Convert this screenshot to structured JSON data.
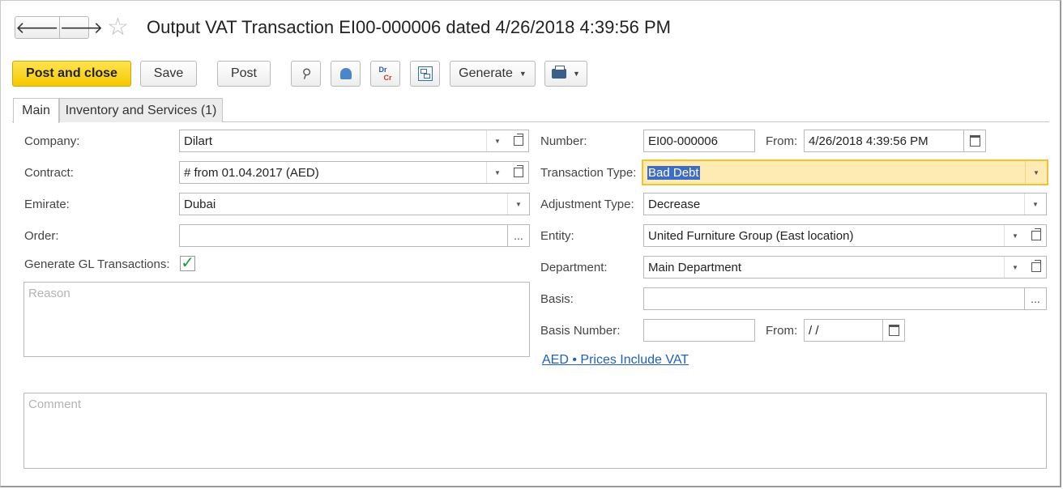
{
  "header": {
    "back_glyph": "🡐",
    "forward_glyph": "🡒",
    "star_glyph": "☆",
    "title": "Output VAT Transaction EI00-000006 dated 4/26/2018 4:39:56 PM"
  },
  "toolbar": {
    "post_and_close": "Post and close",
    "save": "Save",
    "post": "Post",
    "dr": "Dr",
    "cr": "Cr",
    "generate": "Generate",
    "clip_glyph": "⚲"
  },
  "tabs": [
    {
      "label": "Main"
    },
    {
      "label": "Inventory and Services (1)"
    }
  ],
  "form": {
    "company_label": "Company:",
    "company_value": "Dilart",
    "contract_label": "Contract:",
    "contract_value": "#  from 01.04.2017 (AED)",
    "emirate_label": "Emirate:",
    "emirate_value": "Dubai",
    "order_label": "Order:",
    "order_value": "",
    "gl_label": "Generate GL Transactions:",
    "gl_checked_glyph": "✓",
    "reason_placeholder": "Reason",
    "number_label": "Number:",
    "number_value": "EI00-000006",
    "from_label": "From:",
    "from_value": "4/26/2018  4:39:56 PM",
    "transaction_type_label": "Transaction Type:",
    "transaction_type_value": "Bad Debt",
    "adjustment_type_label": "Adjustment Type:",
    "adjustment_type_value": "Decrease",
    "entity_label": "Entity:",
    "entity_value": "United Furniture Group (East location)",
    "department_label": "Department:",
    "department_value": "Main Department",
    "basis_label": "Basis:",
    "basis_value": "",
    "basis_number_label": "Basis Number:",
    "basis_number_value": "",
    "basis_from_label": "From:",
    "basis_from_value": " /  /",
    "prices_link": "AED • Prices Include VAT",
    "comment_placeholder": "Comment"
  },
  "colors": {
    "accent": "#f5c800",
    "highlight": "#feeab3",
    "selection": "#3e6bc4",
    "link": "#1f5fbf"
  }
}
